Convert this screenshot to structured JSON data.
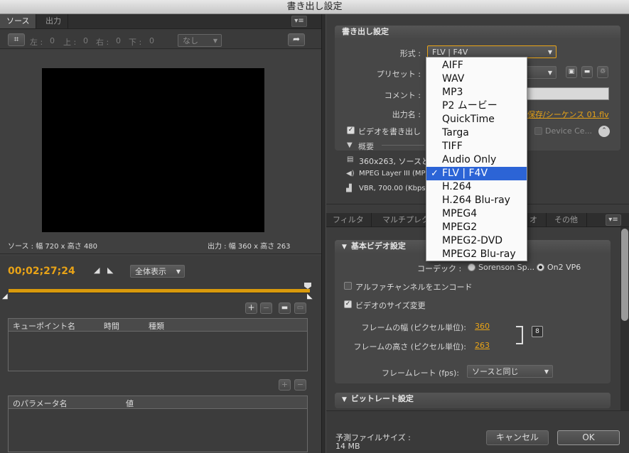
{
  "window": {
    "title": "書き出し設定"
  },
  "left": {
    "tabs": [
      {
        "label": "ソース"
      },
      {
        "label": "出力"
      }
    ],
    "crop": {
      "left_label": "左 :",
      "left": "0",
      "top_label": "上 :",
      "top": "0",
      "right_label": "右 :",
      "right": "0",
      "bottom_label": "下 :",
      "bottom": "0",
      "ratio": "なし"
    },
    "source_info": "ソース : 幅 720 x 高さ 480",
    "output_info": "出力 : 幅 360 x 高さ 263",
    "timecode": "00;02;27;24",
    "zoom": "全体表示",
    "cue_headers": {
      "name": "キューポイント名",
      "time": "時間",
      "type": "種類"
    },
    "param_headers": {
      "name": "のパラメータ名",
      "value": "値"
    }
  },
  "export": {
    "header": "書き出し設定",
    "format_label": "形式 :",
    "format_value": "FLV | F4V",
    "preset_label": "プリセット :",
    "comment_label": "コメント :",
    "output_label": "出力名 :",
    "output_value": "保存/シーケンス 01.flv",
    "export_video": "ビデオを書き出し",
    "device_label": "Device Ce...",
    "summary": "概要",
    "summary_video": "360x263, ソースと",
    "summary_audio": "MPEG Layer III (MP",
    "summary_bitrate": "VBR, 700.00 (Kbps"
  },
  "format_options": [
    "AIFF",
    "WAV",
    "MP3",
    "P2 ムービー",
    "QuickTime",
    "Targa",
    "TIFF",
    "Audio Only",
    "FLV | F4V",
    "H.264",
    "H.264 Blu-ray",
    "MPEG4",
    "MPEG2",
    "MPEG2-DVD",
    "MPEG2 Blu-ray"
  ],
  "format_selected_index": 8,
  "right_tabs": [
    {
      "label": "フィルタ"
    },
    {
      "label": "マルチプレク"
    },
    {
      "label": "オ"
    },
    {
      "label": "その他"
    }
  ],
  "video": {
    "header": "基本ビデオ設定",
    "codec_label": "コーデック :",
    "codec_opt1": "Sorenson Sp...",
    "codec_opt2": "On2 VP6",
    "alpha": "アルファチャンネルをエンコード",
    "resize": "ビデオのサイズ変更",
    "width_label": "フレームの幅 (ピクセル単位):",
    "width": "360",
    "height_label": "フレームの高さ (ピクセル単位):",
    "height": "263",
    "fps_label": "フレームレート (fps):",
    "fps": "ソースと同じ"
  },
  "bitrate": {
    "header": "ビットレート設定"
  },
  "footer": {
    "filesize_label": "予測ファイルサイズ :",
    "filesize": "14 MB",
    "cancel": "キャンセル",
    "ok": "OK"
  },
  "colors": {
    "accent": "#e8a317",
    "selection": "#2c64d6"
  }
}
